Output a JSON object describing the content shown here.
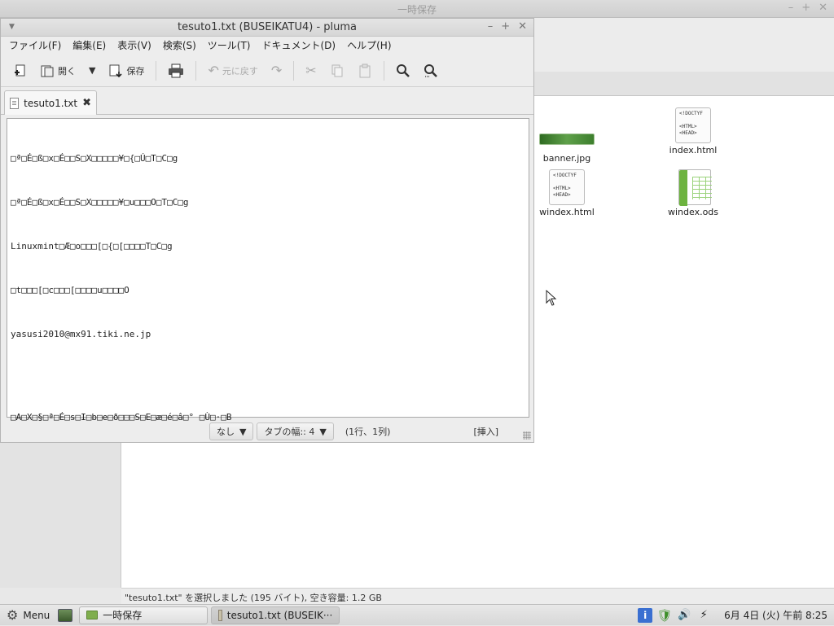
{
  "background_window": {
    "title": "一時保存",
    "controls": [
      "–",
      "+",
      "✕"
    ],
    "status": "\"tesuto1.txt\" を選択しました (195 バイト), 空き容量: 1.2 GB",
    "files": [
      {
        "name": "banner.jpg",
        "kind": "jpg"
      },
      {
        "name": "index.html",
        "kind": "html"
      },
      {
        "name": "windex.html",
        "kind": "html"
      },
      {
        "name": "windex.ods",
        "kind": "ods"
      }
    ],
    "html_thumb_text": "<!DOCTYF\n\n<HTML>\n<HEAD>"
  },
  "pluma": {
    "title": "tesuto1.txt (BUSEIKATU4) - pluma",
    "controls": [
      "–",
      "+",
      "✕"
    ],
    "menu": [
      "ファイル(F)",
      "編集(E)",
      "表示(V)",
      "検索(S)",
      "ツール(T)",
      "ドキュメント(D)",
      "ヘルプ(H)"
    ],
    "toolbar": {
      "open_label": "開く",
      "save_label": "保存",
      "undo_label": "元に戻す"
    },
    "tab": {
      "label": "tesuto1.txt"
    },
    "editor_lines": [
      "□ª□É□ß□x□É□□S□X□□□□□¥□{□Ú□T□C□g",
      "□ª□É□ß□x□É□□S□X□□□□□¥□u□□□O□T□C□g",
      "Linuxmint□Æ□o□□□[□{□[□□□□T□C□g",
      "□t□□□[□c□□□[□□□□u□□□□O",
      "yasusi2010@mx91.tiki.ne.jp",
      "",
      "□A□X□§□ª□É□s□I□b□e□ð□□□S□E□æ□é□â□° □Ù□·□B"
    ],
    "status": {
      "highlight": "なし",
      "tab_width": "タブの幅:: 4",
      "position": "(1行、1列)",
      "mode": "[挿入]"
    }
  },
  "panel": {
    "menu_label": "Menu",
    "tasks": [
      "一時保存",
      "tesuto1.txt (BUSEIK···"
    ],
    "clock": "6月 4日 (火) 午前 8:25"
  }
}
